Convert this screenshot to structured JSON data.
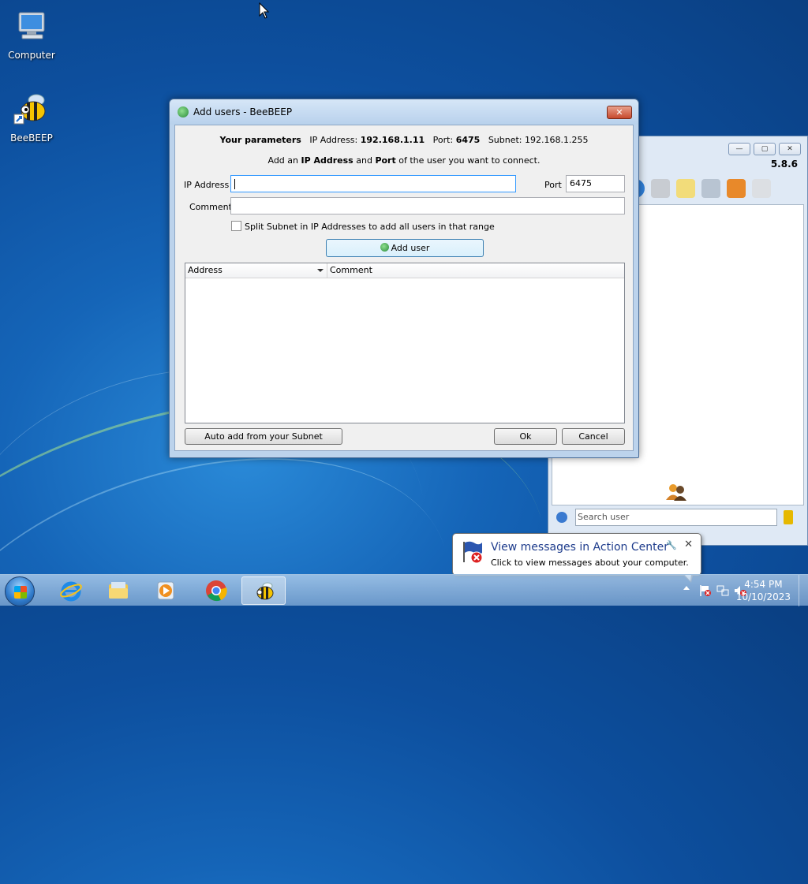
{
  "desktop": {
    "icons": [
      {
        "label": "Computer"
      },
      {
        "label": "BeeBEEP"
      }
    ]
  },
  "bg_window": {
    "version": "5.8.6",
    "search_placeholder": "Search user",
    "controls": [
      "—",
      "▢",
      "✕"
    ]
  },
  "dialog": {
    "title": "Add users - BeeBEEP",
    "close_label": "✕",
    "params": {
      "label": "Your parameters",
      "ip_label": "IP Address:",
      "ip_value": "192.168.1.11",
      "port_label": "Port:",
      "port_value": "6475",
      "subnet_label": "Subnet:",
      "subnet_value": "192.168.1.255"
    },
    "hint": {
      "pre": "Add an ",
      "ip": "IP Address",
      "mid": " and ",
      "port": "Port",
      "post": " of the user you want to connect."
    },
    "ip_address_label": "IP Address",
    "ip_address_value": "",
    "port_label": "Port",
    "port_value": "6475",
    "comment_label": "Comment",
    "comment_value": "",
    "split_subnet_label": "Split Subnet in IP Addresses to add all users in that range",
    "split_subnet_checked": false,
    "add_user_label": "Add user",
    "table": {
      "columns": [
        "Address",
        "Comment"
      ],
      "rows": []
    },
    "auto_add_label": "Auto add from your Subnet",
    "ok_label": "Ok",
    "cancel_label": "Cancel"
  },
  "notification": {
    "title": "View messages in Action Center",
    "subtitle": "Click to view messages about your computer.",
    "close_label": "✕"
  },
  "taskbar": {
    "clock_time": "4:54 PM",
    "clock_date": "10/10/2023"
  }
}
